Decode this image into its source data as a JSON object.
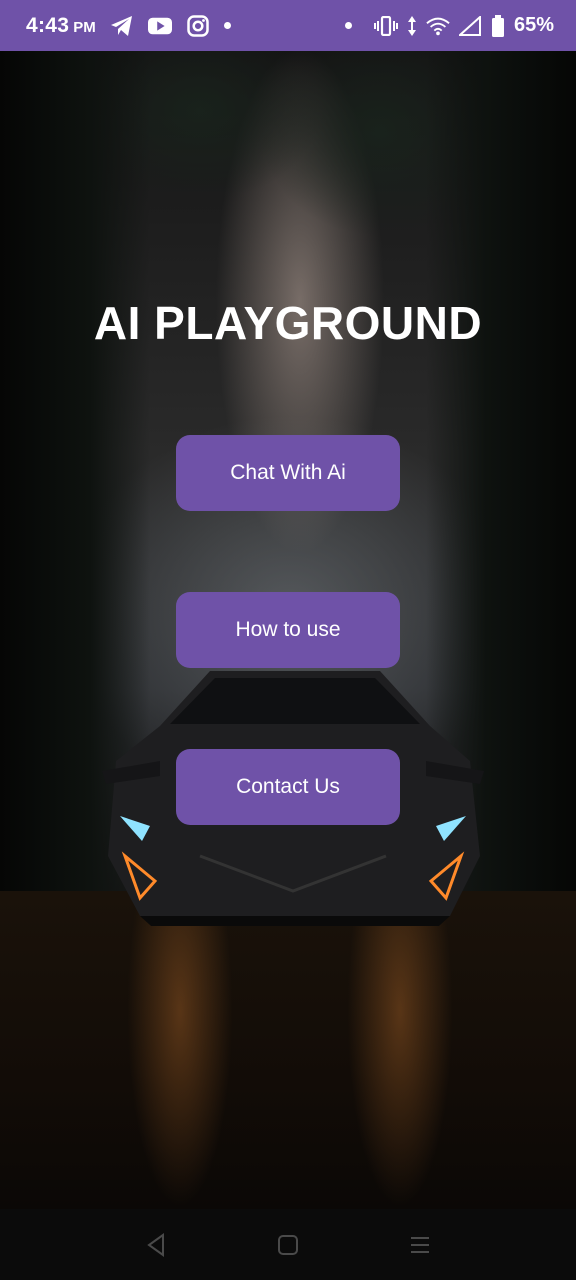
{
  "status_bar": {
    "time": "4:43",
    "ampm": "PM",
    "notification_icons": [
      "telegram-icon",
      "youtube-icon",
      "instagram-icon"
    ],
    "system_icons": [
      "vibrate-icon",
      "data-arrows-icon",
      "wifi-icon",
      "signal-icon",
      "battery-icon"
    ],
    "battery": "65%",
    "color": "#6f52a8"
  },
  "main": {
    "title": "AI PLAYGROUND",
    "buttons": [
      {
        "label": "Chat With Ai"
      },
      {
        "label": "How to use"
      },
      {
        "label": "Contact Us"
      }
    ],
    "button_color": "#6f52a8"
  },
  "nav_bar": {
    "items": [
      "back-icon",
      "home-icon",
      "recents-icon"
    ]
  }
}
